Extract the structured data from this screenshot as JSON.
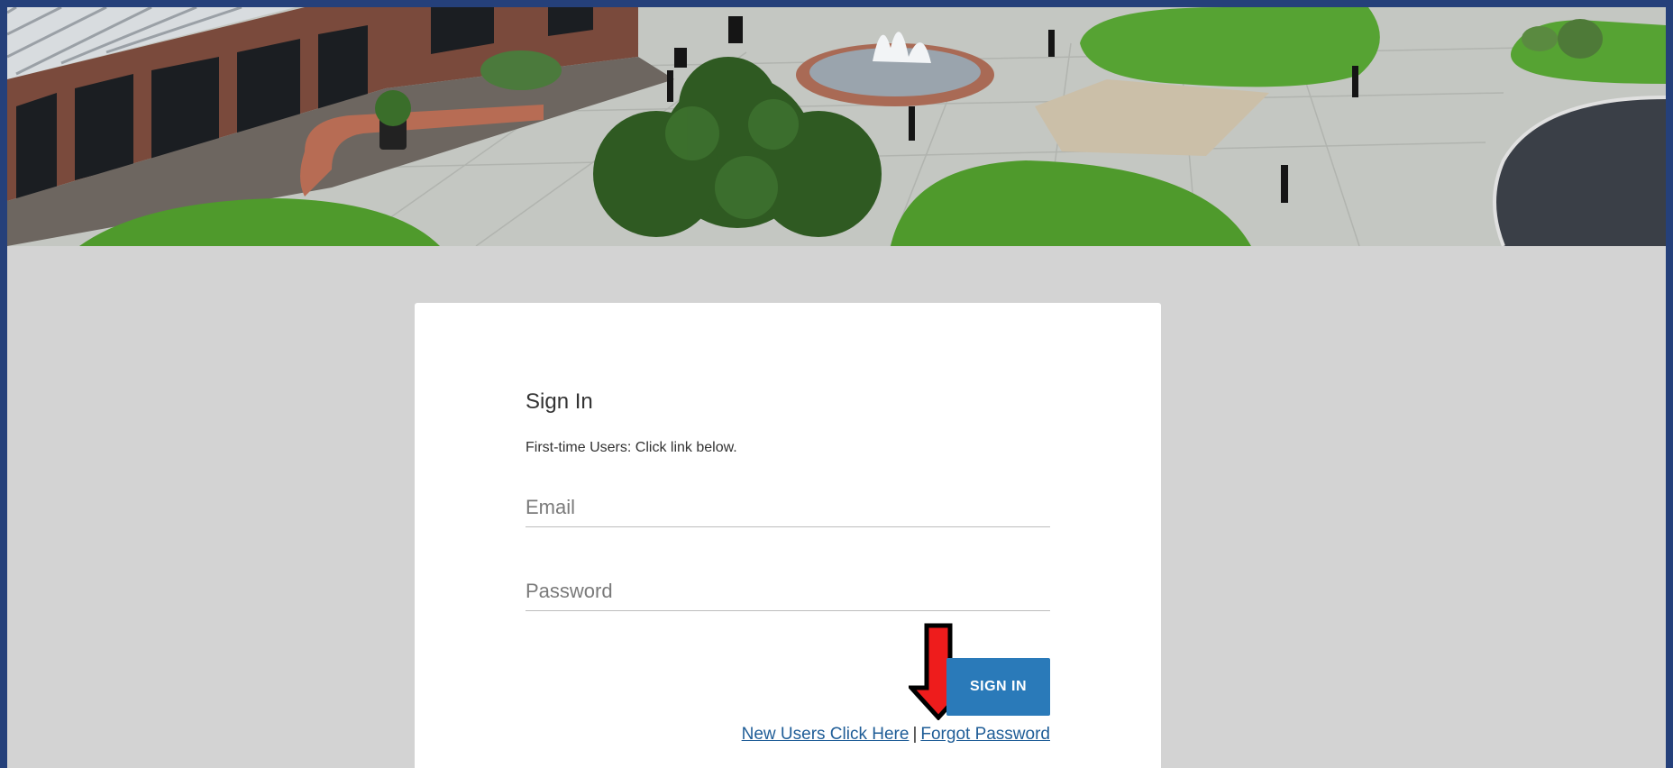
{
  "signin": {
    "title": "Sign In",
    "hint": "First-time Users: Click link below.",
    "email_placeholder": "Email",
    "password_placeholder": "Password",
    "button_label": "SIGN IN",
    "new_users_link": "New Users Click Here",
    "separator": "|",
    "forgot_password_link": "Forgot Password"
  },
  "colors": {
    "frame_border": "#25407a",
    "page_background": "#d3d3d3",
    "button": "#2a7ab9",
    "link": "#1f5d97",
    "annotation_arrow": "#ee1c1c"
  },
  "icons": {
    "annotation": "down-arrow-icon"
  }
}
